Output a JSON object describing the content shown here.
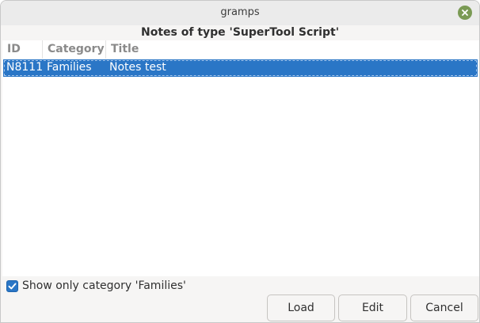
{
  "window": {
    "title": "gramps"
  },
  "heading": "Notes of type 'SuperTool Script'",
  "table": {
    "columns": [
      "ID",
      "Category",
      "Title"
    ],
    "rows": [
      {
        "id": "N8111",
        "category": "Families",
        "title": "Notes test",
        "selected": true
      }
    ]
  },
  "filter": {
    "label": "Show only category 'Families'",
    "checked": true
  },
  "buttons": {
    "load": "Load",
    "edit": "Edit",
    "cancel": "Cancel"
  },
  "colors": {
    "selection": "#2a76c6",
    "close_button": "#7a9a54"
  },
  "icons": {
    "close": "close-icon",
    "check": "check-icon"
  }
}
